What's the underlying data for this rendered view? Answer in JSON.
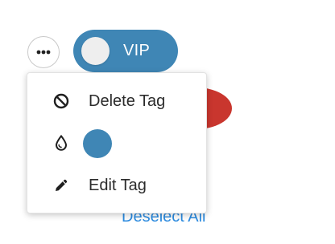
{
  "tag": {
    "label": "VIP",
    "color": "#3f86b5"
  },
  "background_element_color": "#c9362e",
  "link_color": "#2b8be0",
  "menu": {
    "items": [
      {
        "label": "Delete Tag",
        "icon": "ban-icon"
      },
      {
        "label": "",
        "icon": "droplet-icon",
        "swatch_color": "#3f86b5"
      },
      {
        "label": "Edit Tag",
        "icon": "pencil-icon"
      }
    ]
  },
  "footer": {
    "deselect_label": "Deselect All"
  }
}
